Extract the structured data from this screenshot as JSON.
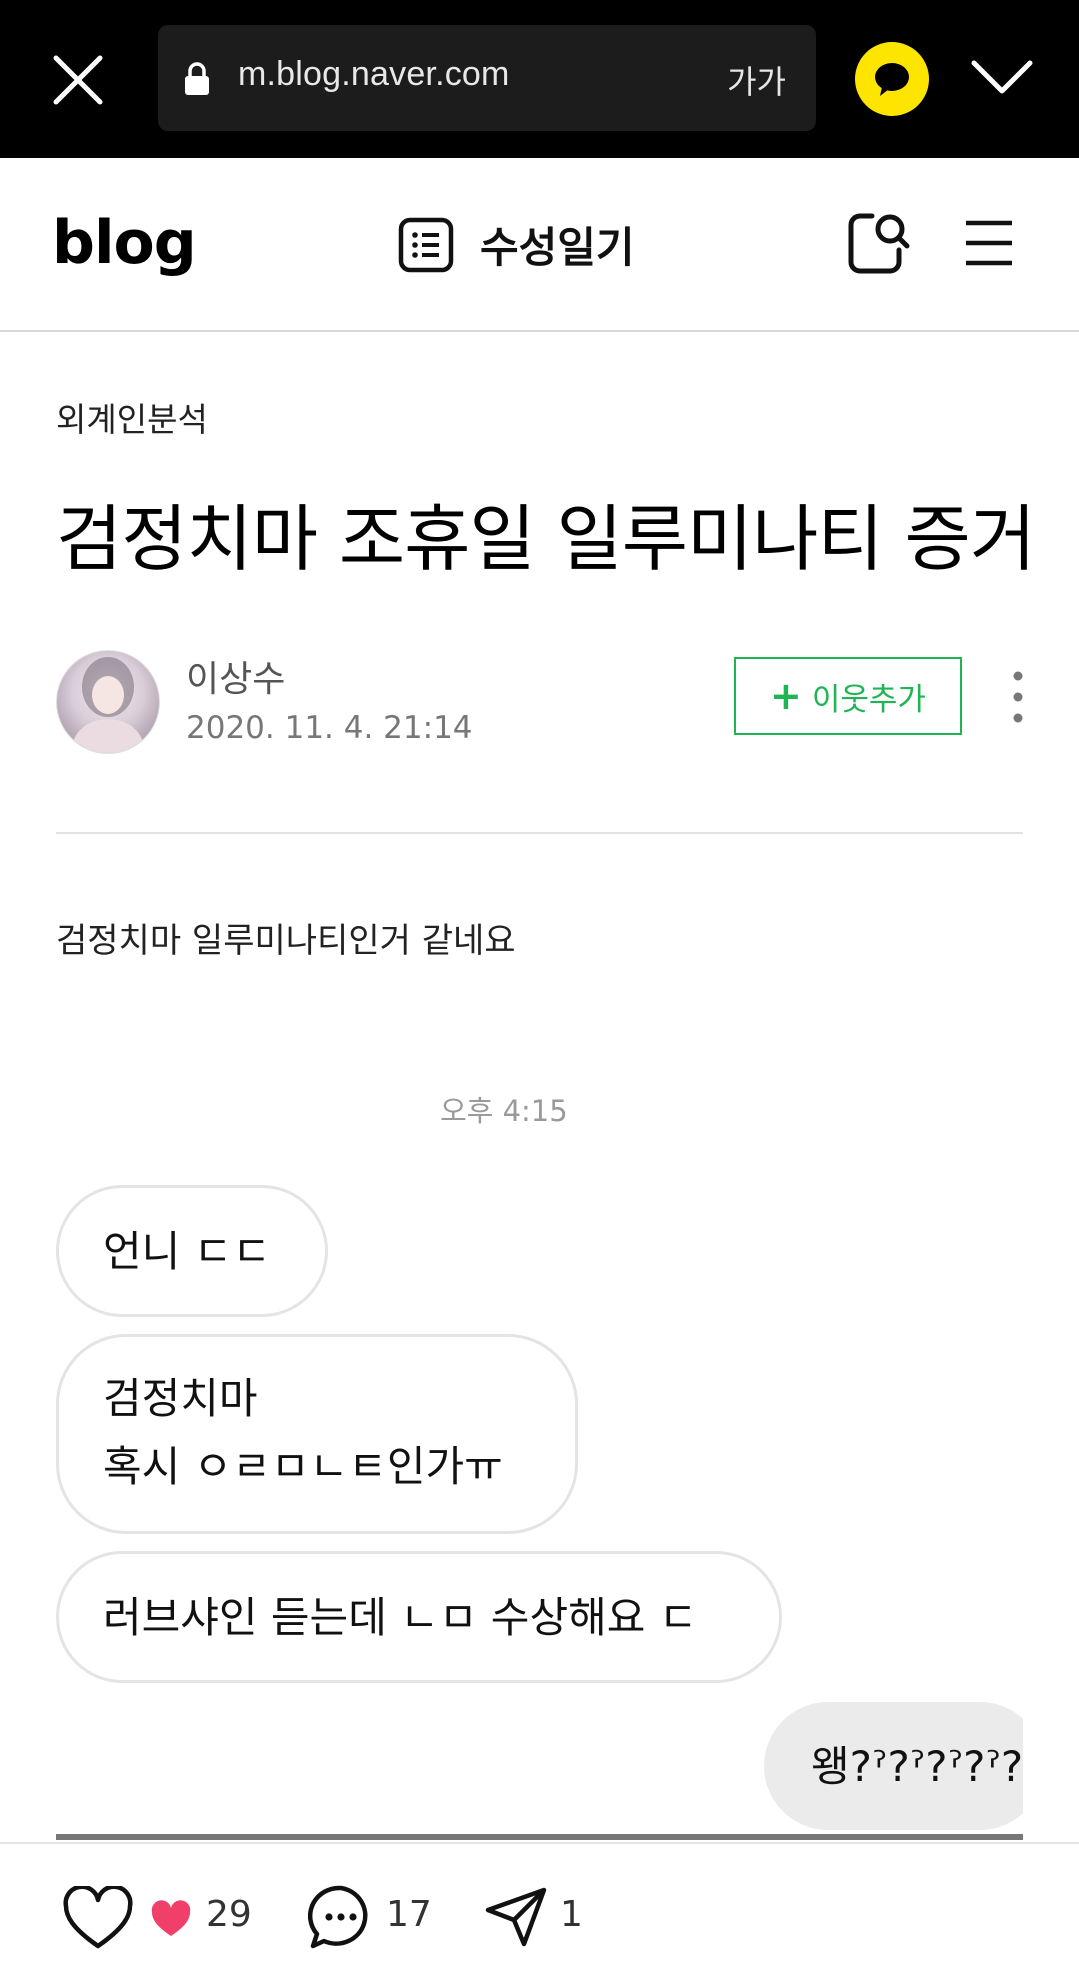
{
  "browser": {
    "url": "m.blog.naver.com",
    "font_size_label": "가가",
    "icons": [
      "close-icon",
      "lock-icon",
      "kakao-talk-icon",
      "chevron-down-icon"
    ],
    "kakao_color": "#fee500"
  },
  "header": {
    "logo": "blog",
    "blog_name": "수성일기",
    "icons": [
      "list-icon",
      "search-icon",
      "menu-icon"
    ]
  },
  "post": {
    "category": "외계인분석",
    "title": "검정치마 조휴일 일루미나티 증거",
    "author": "이상수",
    "date": "2020. 11. 4. 21:14",
    "add_neighbor_label": "이웃추가",
    "add_neighbor_plus": "+",
    "body": "검정치마 일루미나티인거 같네요",
    "accent_color": "#1fb454"
  },
  "chat": {
    "time": "오후 4:15",
    "bubbles": [
      {
        "lines": [
          "언니 ㄷㄷ"
        ]
      },
      {
        "lines": [
          "검정치마",
          "혹시 ㅇㄹㅁㄴㅌ인가ㅠ"
        ]
      },
      {
        "lines": [
          "러브샤인 듣는데 ㄴㅁ 수상해요 ㄷ"
        ]
      },
      {
        "lines": [
          "왱?ˀ?ˀ?ˀ?ˀ?"
        ]
      }
    ]
  },
  "actions": {
    "like_count": "29",
    "comment_count": "17",
    "share_count": "1",
    "icons": [
      "heart-icon",
      "comment-icon",
      "share-icon"
    ],
    "like_color": "#f0406a"
  }
}
